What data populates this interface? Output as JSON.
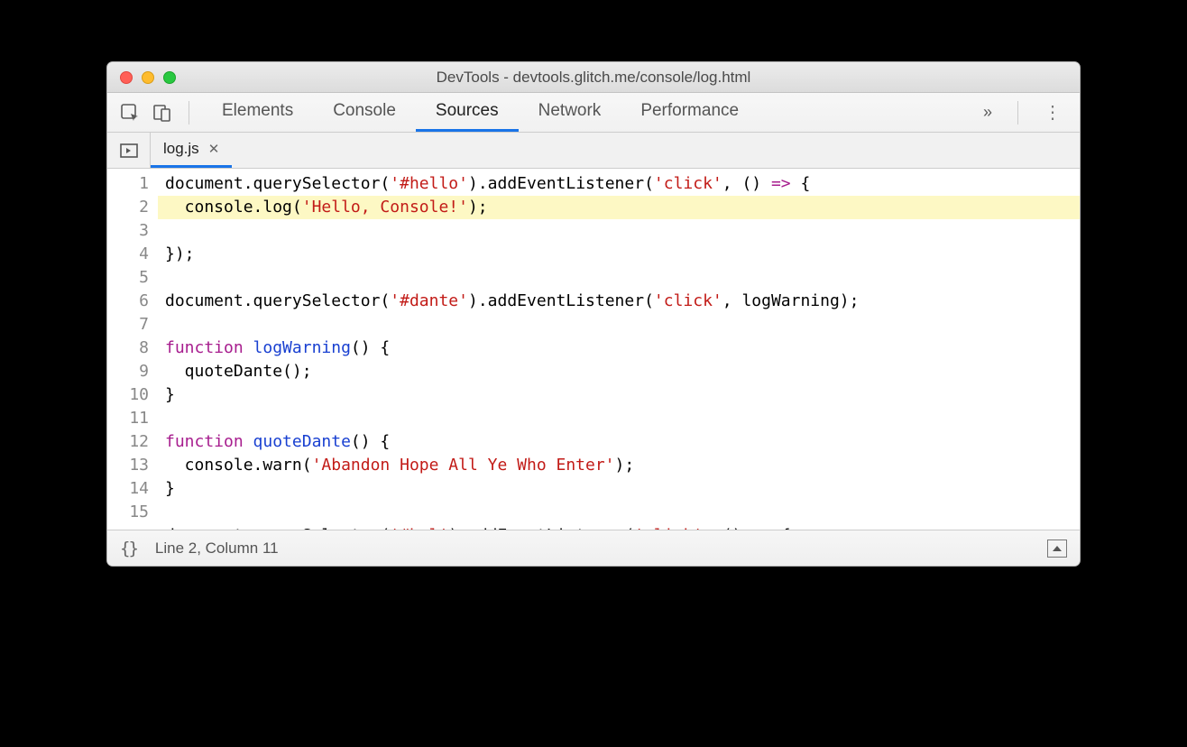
{
  "window": {
    "title": "DevTools - devtools.glitch.me/console/log.html"
  },
  "toolbar": {
    "tabs": [
      "Elements",
      "Console",
      "Sources",
      "Network",
      "Performance"
    ],
    "activeIndex": 2
  },
  "fileTabs": {
    "active": "log.js"
  },
  "source": {
    "lineNumbers": [
      "1",
      "2",
      "3",
      "4",
      "5",
      "6",
      "7",
      "8",
      "9",
      "10",
      "11",
      "12",
      "13",
      "14",
      "15"
    ],
    "highlightLines": [
      2
    ],
    "lines": [
      [
        {
          "t": "document",
          "c": "pn"
        },
        {
          "t": ".",
          "c": "pn"
        },
        {
          "t": "querySelector",
          "c": "pn"
        },
        {
          "t": "(",
          "c": "pn"
        },
        {
          "t": "'#hello'",
          "c": "str"
        },
        {
          "t": ").",
          "c": "pn"
        },
        {
          "t": "addEventListener",
          "c": "pn"
        },
        {
          "t": "(",
          "c": "pn"
        },
        {
          "t": "'click'",
          "c": "str"
        },
        {
          "t": ", () ",
          "c": "pn"
        },
        {
          "t": "=>",
          "c": "kw"
        },
        {
          "t": " {",
          "c": "pn"
        }
      ],
      [
        {
          "t": "  console.",
          "c": "pn"
        },
        {
          "t": "log",
          "c": "pn"
        },
        {
          "t": "(",
          "c": "pn"
        },
        {
          "t": "'Hello, Console!'",
          "c": "str"
        },
        {
          "t": ");",
          "c": "pn"
        }
      ],
      [
        {
          "t": "});",
          "c": "pn"
        }
      ],
      [
        {
          "t": "",
          "c": "pn"
        }
      ],
      [
        {
          "t": "document",
          "c": "pn"
        },
        {
          "t": ".",
          "c": "pn"
        },
        {
          "t": "querySelector",
          "c": "pn"
        },
        {
          "t": "(",
          "c": "pn"
        },
        {
          "t": "'#dante'",
          "c": "str"
        },
        {
          "t": ").",
          "c": "pn"
        },
        {
          "t": "addEventListener",
          "c": "pn"
        },
        {
          "t": "(",
          "c": "pn"
        },
        {
          "t": "'click'",
          "c": "str"
        },
        {
          "t": ", logWarning);",
          "c": "pn"
        }
      ],
      [
        {
          "t": "",
          "c": "pn"
        }
      ],
      [
        {
          "t": "function",
          "c": "kw"
        },
        {
          "t": " ",
          "c": "pn"
        },
        {
          "t": "logWarning",
          "c": "fn"
        },
        {
          "t": "() {",
          "c": "pn"
        }
      ],
      [
        {
          "t": "  quoteDante();",
          "c": "pn"
        }
      ],
      [
        {
          "t": "}",
          "c": "pn"
        }
      ],
      [
        {
          "t": "",
          "c": "pn"
        }
      ],
      [
        {
          "t": "function",
          "c": "kw"
        },
        {
          "t": " ",
          "c": "pn"
        },
        {
          "t": "quoteDante",
          "c": "fn"
        },
        {
          "t": "() {",
          "c": "pn"
        }
      ],
      [
        {
          "t": "  console.",
          "c": "pn"
        },
        {
          "t": "warn",
          "c": "pn"
        },
        {
          "t": "(",
          "c": "pn"
        },
        {
          "t": "'Abandon Hope All Ye Who Enter'",
          "c": "str"
        },
        {
          "t": ");",
          "c": "pn"
        }
      ],
      [
        {
          "t": "}",
          "c": "pn"
        }
      ],
      [
        {
          "t": "",
          "c": "pn"
        }
      ],
      [
        {
          "t": "document",
          "c": "pn"
        },
        {
          "t": ".",
          "c": "pn"
        },
        {
          "t": "querySelector",
          "c": "pn"
        },
        {
          "t": "(",
          "c": "pn"
        },
        {
          "t": "'#hal'",
          "c": "str"
        },
        {
          "t": ").",
          "c": "pn"
        },
        {
          "t": "addEventListener",
          "c": "pn"
        },
        {
          "t": "(",
          "c": "pn"
        },
        {
          "t": "'click'",
          "c": "str"
        },
        {
          "t": ", () ",
          "c": "pn"
        },
        {
          "t": "=>",
          "c": "kw"
        },
        {
          "t": " {",
          "c": "pn"
        }
      ]
    ]
  },
  "status": {
    "cursor": "Line 2, Column 11"
  }
}
